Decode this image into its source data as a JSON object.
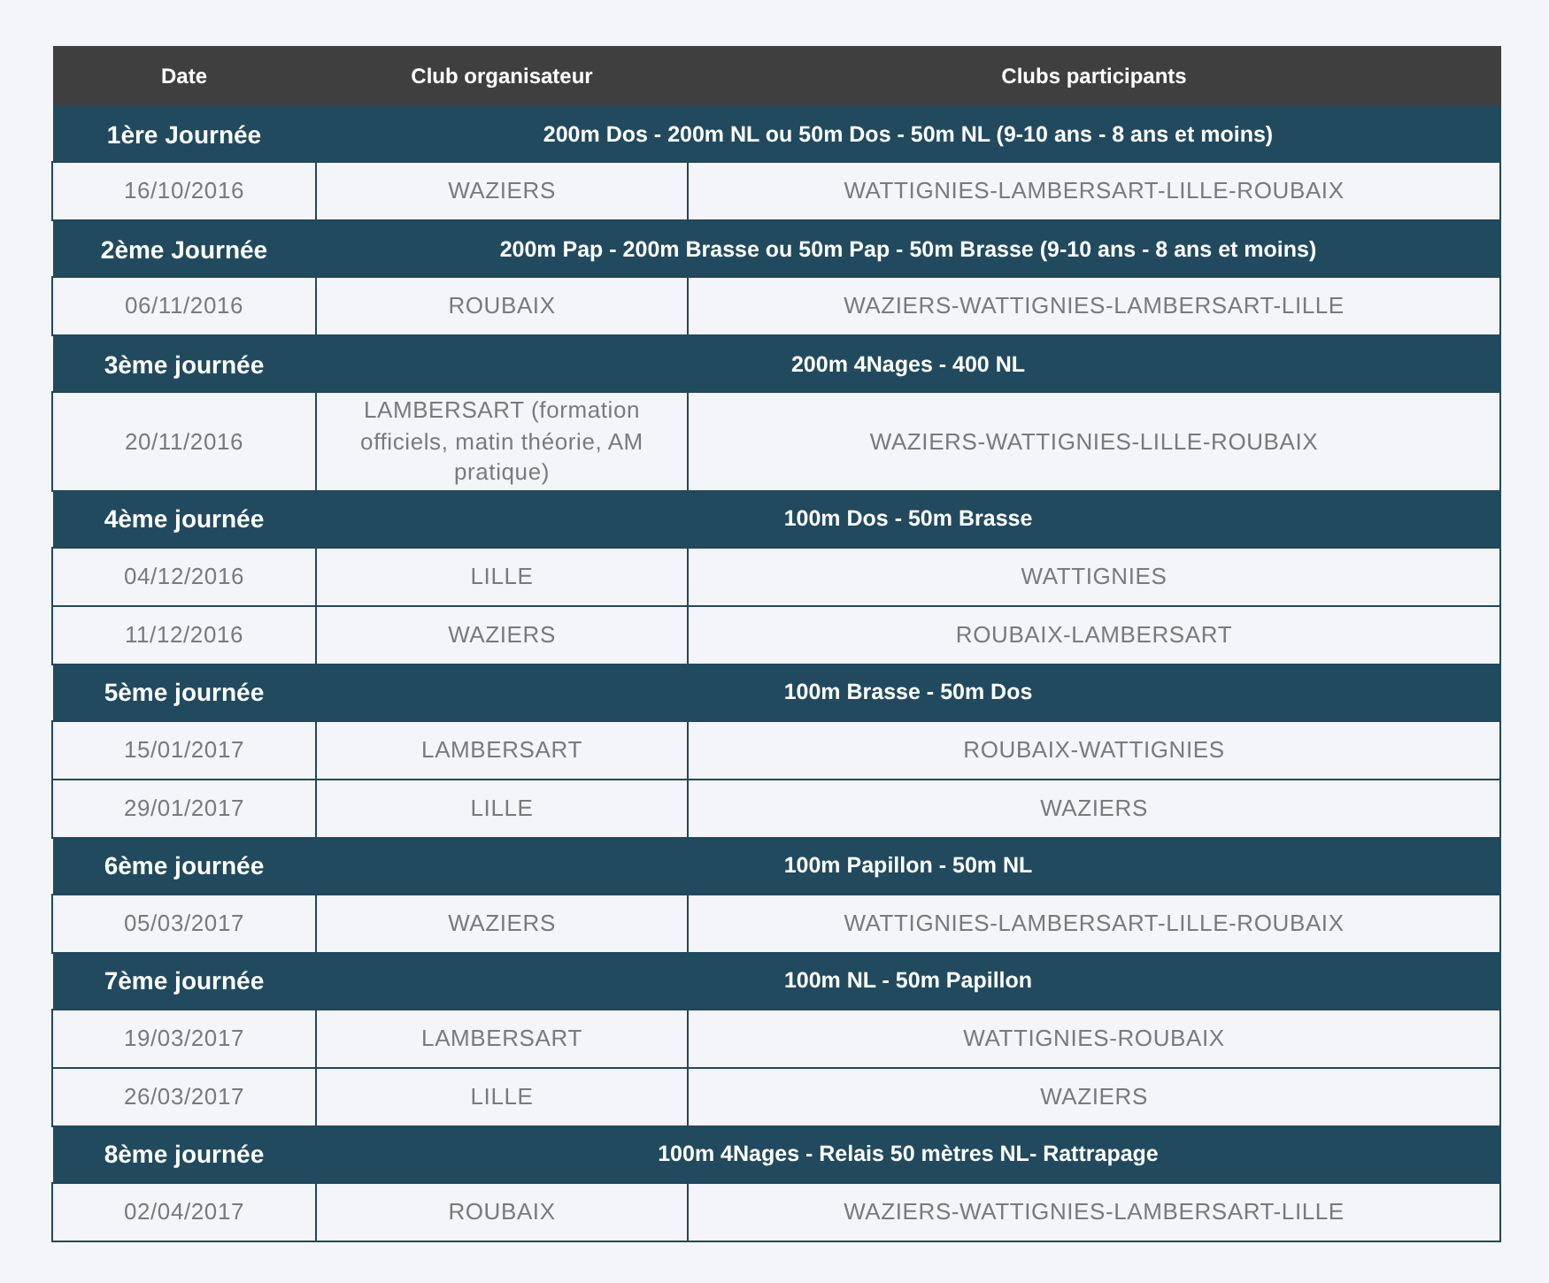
{
  "table": {
    "columns": [
      "Date",
      "Club organisateur",
      "Clubs participants"
    ],
    "journees": [
      {
        "title": "1ère Journée",
        "events": "200m Dos - 200m NL ou 50m Dos - 50m NL (9-10 ans - 8 ans et moins)",
        "meetings": [
          {
            "date": "16/10/2016",
            "club": "WAZIERS",
            "participants": "WATTIGNIES-LAMBERSART-LILLE-ROUBAIX"
          }
        ]
      },
      {
        "title": "2ème Journée",
        "events": "200m Pap - 200m Brasse ou 50m Pap - 50m Brasse (9-10 ans - 8 ans et moins)",
        "meetings": [
          {
            "date": "06/11/2016",
            "club": "ROUBAIX",
            "participants": "WAZIERS-WATTIGNIES-LAMBERSART-LILLE"
          }
        ]
      },
      {
        "title": "3ème journée",
        "events": "200m 4Nages - 400 NL",
        "meetings": [
          {
            "date": "20/11/2016",
            "club": "LAMBERSART (formation officiels, matin théorie, AM pratique)",
            "participants": "WAZIERS-WATTIGNIES-LILLE-ROUBAIX"
          }
        ]
      },
      {
        "title": "4ème journée",
        "events": "100m Dos - 50m Brasse",
        "meetings": [
          {
            "date": "04/12/2016",
            "club": "LILLE",
            "participants": "WATTIGNIES"
          },
          {
            "date": "11/12/2016",
            "club": "WAZIERS",
            "participants": "ROUBAIX-LAMBERSART"
          }
        ]
      },
      {
        "title": "5ème journée",
        "events": "100m Brasse - 50m Dos",
        "meetings": [
          {
            "date": "15/01/2017",
            "club": "LAMBERSART",
            "participants": "ROUBAIX-WATTIGNIES"
          },
          {
            "date": "29/01/2017",
            "club": "LILLE",
            "participants": "WAZIERS"
          }
        ]
      },
      {
        "title": "6ème journée",
        "events": "100m Papillon - 50m NL",
        "meetings": [
          {
            "date": "05/03/2017",
            "club": "WAZIERS",
            "participants": "WATTIGNIES-LAMBERSART-LILLE-ROUBAIX"
          }
        ]
      },
      {
        "title": "7ème journée",
        "events": "100m NL - 50m Papillon",
        "meetings": [
          {
            "date": "19/03/2017",
            "club": "LAMBERSART",
            "participants": "WATTIGNIES-ROUBAIX"
          },
          {
            "date": "26/03/2017",
            "club": "LILLE",
            "participants": "WAZIERS"
          }
        ]
      },
      {
        "title": "8ème journée",
        "events": "100m 4Nages - Relais 50 mètres NL- Rattrapage",
        "meetings": [
          {
            "date": "02/04/2017",
            "club": "ROUBAIX",
            "participants": "WAZIERS-WATTIGNIES-LAMBERSART-LILLE"
          }
        ]
      }
    ]
  }
}
